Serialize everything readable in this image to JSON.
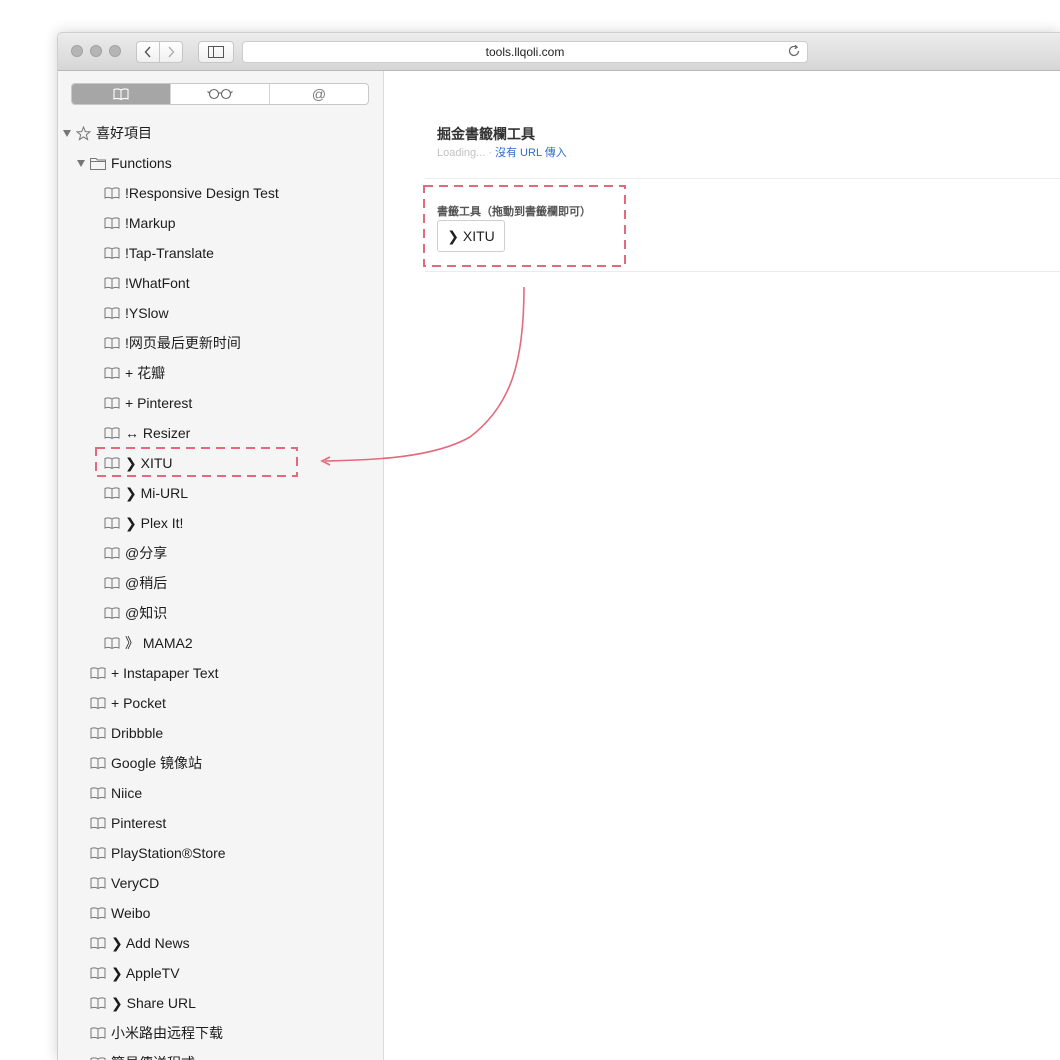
{
  "browser": {
    "url": "tools.llqoli.com"
  },
  "sidebar": {
    "favorites_label": "喜好項目",
    "folder_label": "Functions",
    "folder_items": [
      "!Responsive Design Test",
      "!Markup",
      "!Tap-Translate",
      "!WhatFont",
      "!YSlow",
      "!网页最后更新时间",
      "+ 花瓣",
      "+ Pinterest",
      "↔ Resizer",
      "❯ XITU",
      "❯ Mi-URL",
      "❯ Plex It!",
      "@分享",
      "@稍后",
      "@知识",
      "》 MAMA2"
    ],
    "top_items": [
      "+ Instapaper Text",
      "+ Pocket",
      "Dribbble",
      "Google 镜像站",
      "Niice",
      "Pinterest",
      "PlayStation®Store",
      "VeryCD",
      "Weibo",
      "❯ Add News",
      "❯ AppleTV",
      "❯ Share URL",
      "小米路由远程下载",
      "簡易傳送程式"
    ]
  },
  "page": {
    "title": "掘金書籤欄工具",
    "loading": "Loading...",
    "separator": "·",
    "no_url": "沒有 URL 傳入",
    "tool_label": "書籤工具（拖動到書籤欄即可）",
    "tool_button": "❯ XITU"
  },
  "colors": {
    "highlight": "#e36a7d",
    "link": "#2e6fc7"
  },
  "icons": {
    "bookmark": "open-book-icon",
    "favorites": "star-icon",
    "folder": "folder-icon"
  }
}
